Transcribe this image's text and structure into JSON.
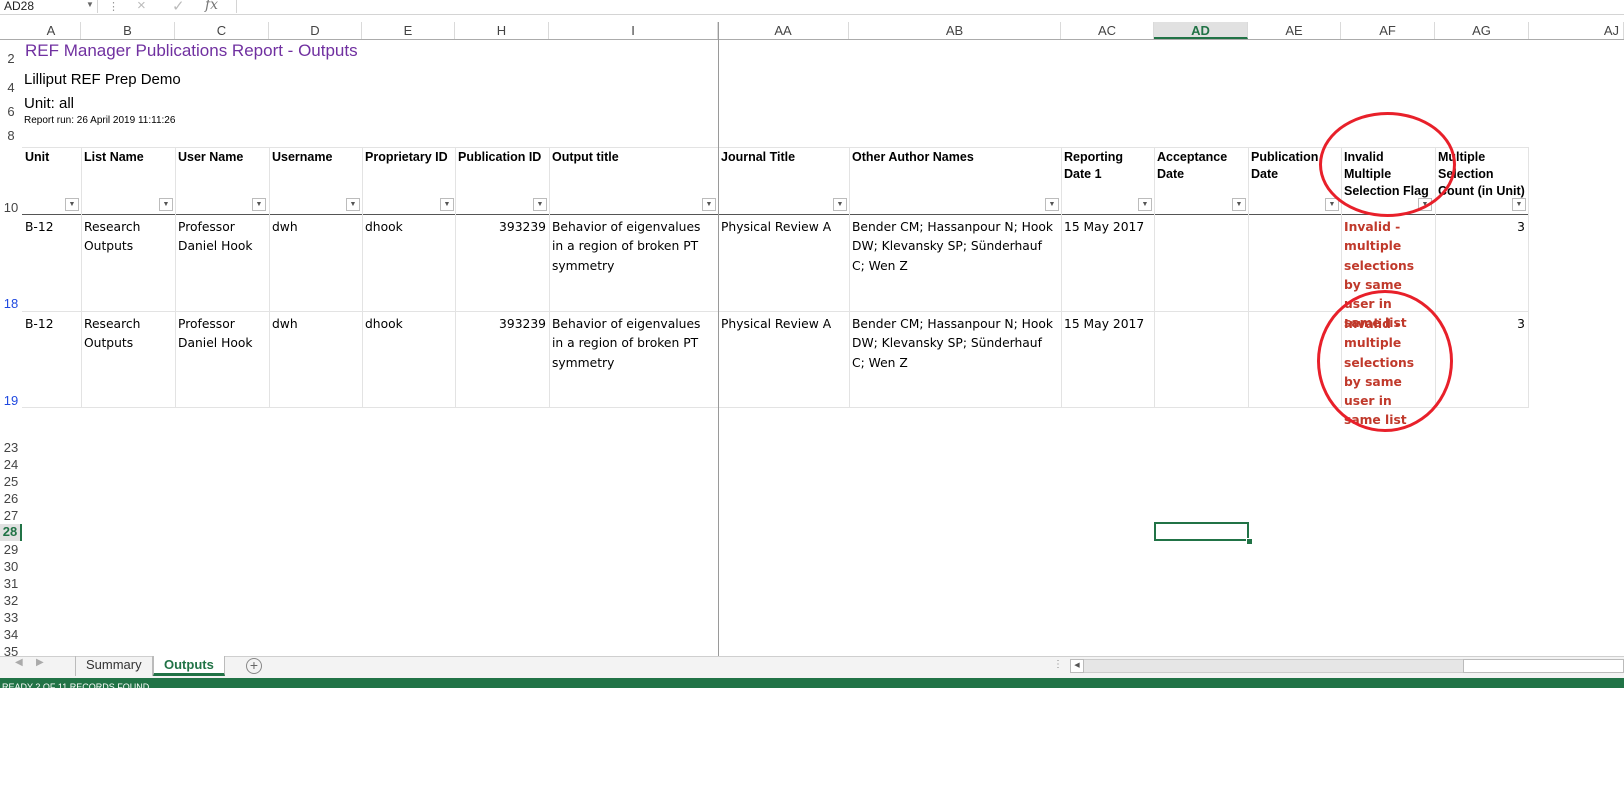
{
  "formula_bar": {
    "name_box": "AD28",
    "fx": "fx",
    "cancel_icon": "×",
    "enter_icon": "✓"
  },
  "columns": [
    "A",
    "B",
    "C",
    "D",
    "E",
    "H",
    "I",
    "AA",
    "AB",
    "AC",
    "AD",
    "AE",
    "AF",
    "AG",
    "AJ"
  ],
  "selected_column": "AD",
  "rows": [
    "2",
    "4",
    "6",
    "8",
    "10",
    "18",
    "19",
    "23",
    "24",
    "25",
    "26",
    "27",
    "28",
    "29",
    "30",
    "31",
    "32",
    "33",
    "34",
    "35"
  ],
  "selected_row": "28",
  "report": {
    "title": "REF Manager Publications Report - Outputs",
    "subtitle": "Lilliput REF Prep Demo",
    "unit": "Unit: all",
    "report_run": "Report run: 26 April 2019 11:11:26"
  },
  "table": {
    "headers": {
      "unit": "Unit",
      "list_name": "List Name",
      "user_name": "User Name",
      "username": "Username",
      "proprietary_id": "Proprietary ID",
      "publication_id": "Publication ID",
      "output_title": "Output title",
      "journal_title": "Journal Title",
      "other_authors": "Other Author Names",
      "reporting_date": "Reporting Date 1",
      "acceptance_date": "Acceptance Date",
      "publication_date": "Publication Date",
      "invalid_flag": "Invalid Multiple Selection Flag",
      "multi_count": "Multiple Selection Count (in Unit)"
    },
    "rows": [
      {
        "unit": "B-12",
        "list_name": "Research Outputs",
        "user_name": "Professor Daniel Hook",
        "username": "dwh",
        "proprietary_id": "dhook",
        "publication_id": "393239",
        "output_title": "Behavior of eigenvalues in a region of broken PT symmetry",
        "journal_title": "Physical Review A",
        "other_authors": "Bender CM; Hassanpour N; Hook DW; Klevansky SP; Sünderhauf C; Wen Z",
        "reporting_date": "15 May 2017",
        "invalid_flag": "Invalid - multiple selections by same user in same list",
        "multi_count": "3"
      },
      {
        "unit": "B-12",
        "list_name": "Research Outputs",
        "user_name": "Professor Daniel Hook",
        "username": "dwh",
        "proprietary_id": "dhook",
        "publication_id": "393239",
        "output_title": "Behavior of eigenvalues in a region of broken PT symmetry",
        "journal_title": "Physical Review A",
        "other_authors": "Bender CM; Hassanpour N; Hook DW; Klevansky SP; Sünderhauf C; Wen Z",
        "reporting_date": "15 May 2017",
        "invalid_flag": "Invalid - multiple selections by same user in same list",
        "multi_count": "3"
      }
    ]
  },
  "sheet_tabs": {
    "summary": "Summary",
    "outputs": "Outputs",
    "add": "+"
  },
  "status_bar": {
    "text": "READY    2 OF 11 RECORDS FOUND"
  },
  "colors": {
    "accent": "#217346",
    "title": "#7030a0",
    "flag": "#c0392b",
    "annotation": "#e8202a"
  }
}
